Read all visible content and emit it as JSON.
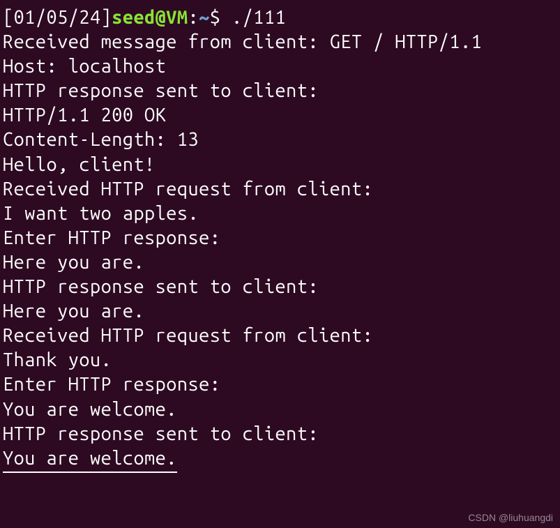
{
  "prompt": {
    "date": "[01/05/24]",
    "user_host": "seed@VM",
    "colon": ":",
    "path": "~",
    "dollar": "$",
    "command": "./111"
  },
  "output_lines": [
    "Received message from client: GET / HTTP/1.1",
    "Host: localhost",
    "",
    "",
    "HTTP response sent to client:",
    "HTTP/1.1 200 OK",
    "Content-Length: 13",
    "",
    "Hello, client!",
    "Received HTTP request from client:",
    "I want two apples.",
    "Enter HTTP response:",
    "Here you are.",
    "HTTP response sent to client:",
    "Here you are.",
    "Received HTTP request from client:",
    "Thank you.",
    "Enter HTTP response:",
    "You are welcome.",
    "HTTP response sent to client:",
    "You are welcome."
  ],
  "watermark": "CSDN @liuhuangdi"
}
